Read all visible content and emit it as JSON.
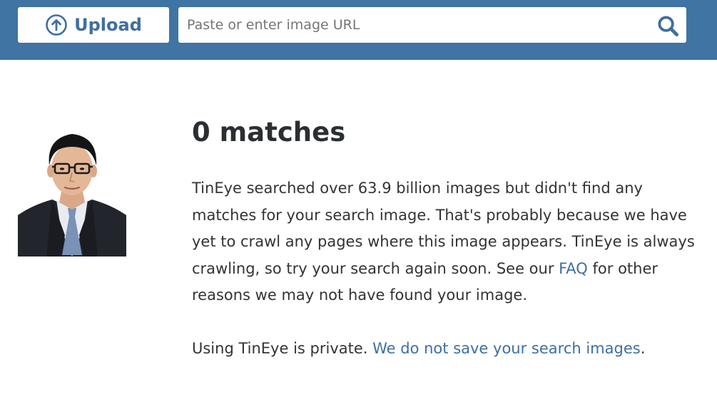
{
  "header": {
    "upload_label": "Upload",
    "search": {
      "placeholder": "Paste or enter image URL",
      "value": ""
    },
    "icons": {
      "upload": "arrow-up-circle-icon",
      "search": "magnifier-icon"
    },
    "colors": {
      "bar": "#3f74a3",
      "accent": "#3f6fa0"
    }
  },
  "result": {
    "heading": "0 matches",
    "p1_text": "TinEye searched over 63.9 billion images but didn't find any matches for your search image. That's probably because we have yet to crawl any pages where this image appears. TinEye is always crawling, so try your search again soon. See our",
    "faq_link": "FAQ",
    "p1_tail": "for other reasons we may not have found your image.",
    "p2_text": "Using TinEye is private.",
    "privacy_link": "We do not save your search images",
    "p2_tail": "."
  }
}
